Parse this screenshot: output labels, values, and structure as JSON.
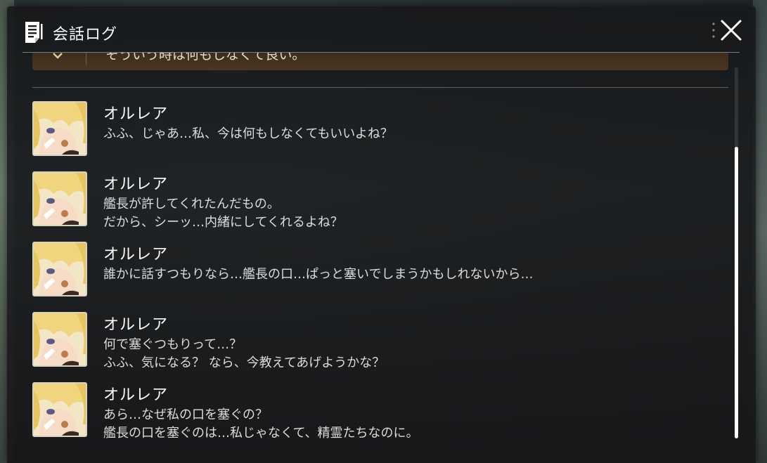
{
  "window": {
    "title": "会話ログ",
    "icons": {
      "log": "log-document-icon",
      "menu": "vertical-dots-icon",
      "close": "close-icon"
    }
  },
  "choice": {
    "text": "そういう時は何もしなくて良い。",
    "icon": "chevron-down-icon"
  },
  "entries": [
    {
      "speaker": "オルレア",
      "avatar": "character-portrait",
      "lines": [
        "ふふ、じゃあ…私、今は何もしなくてもいいよね？"
      ]
    },
    {
      "speaker": "オルレア",
      "avatar": "character-portrait",
      "lines": [
        "艦長が許してくれたんだもの。",
        "だから、シーッ…内緒にしてくれるよね？"
      ]
    },
    {
      "speaker": "オルレア",
      "avatar": "character-portrait",
      "lines": [
        "誰かに話すつもりなら…艦長の口…ぱっと塞いでしまうかもしれないから…"
      ]
    },
    {
      "speaker": "オルレア",
      "avatar": "character-portrait",
      "lines": [
        "何で塞ぐつもりって…？",
        "ふふ、気になる？ なら、今教えてあげようかな？"
      ]
    },
    {
      "speaker": "オルレア",
      "avatar": "character-portrait",
      "lines": [
        "あら…なぜ私の口を塞ぐの？",
        "艦長の口を塞ぐのは…私じゃなくて、精霊たちなのに。"
      ]
    }
  ],
  "colors": {
    "panel": "#1b1d1f",
    "choice_bar": "#4a3320",
    "text": "#dcdcdc",
    "title": "#ffffff"
  }
}
